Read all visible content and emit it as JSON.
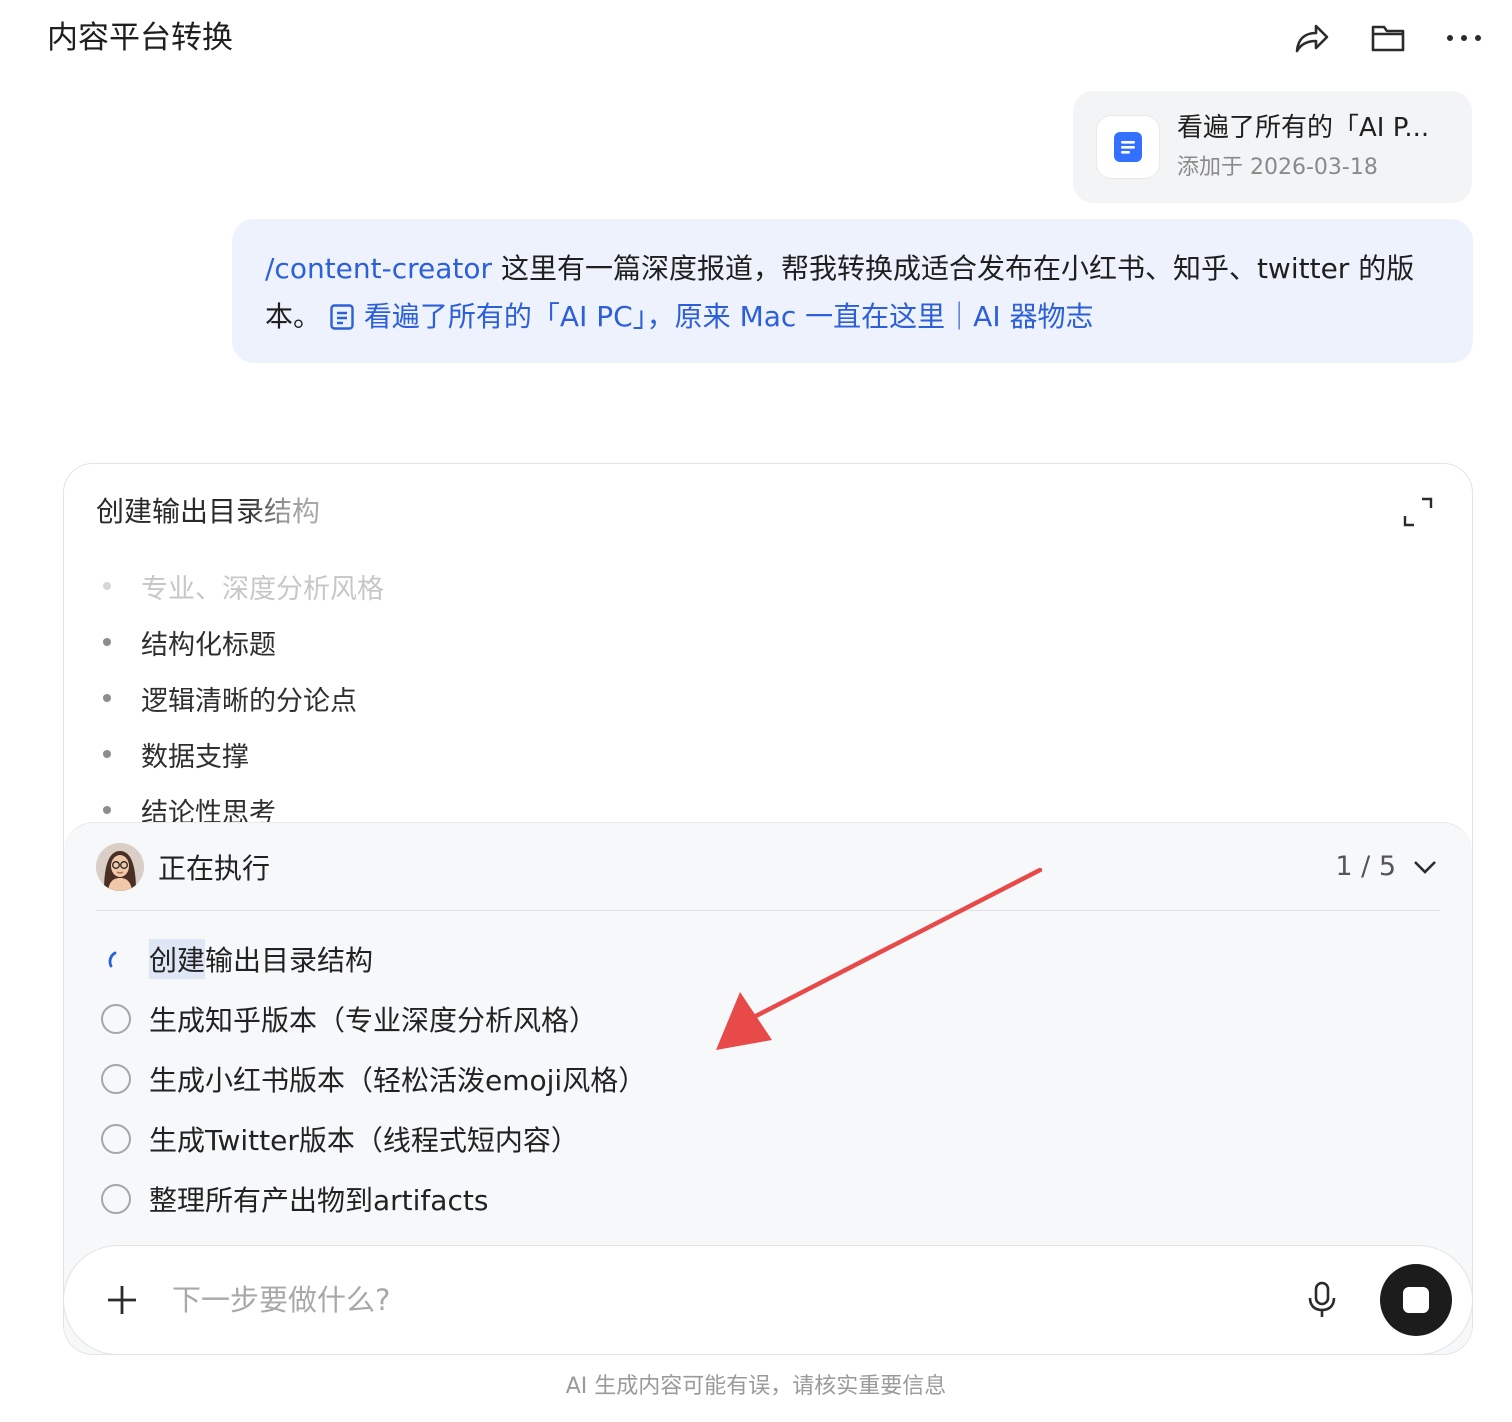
{
  "header": {
    "title": "内容平台转换",
    "actions": [
      "share-icon",
      "folder-icon",
      "more-icon"
    ]
  },
  "attachment": {
    "title": "看遍了所有的「AI P...",
    "date": "添加于 2026-03-18",
    "icon": "document-icon",
    "icon_color": "#3370ff"
  },
  "user_message": {
    "command": "/content-creator",
    "text": " 这里有一篇深度报道，帮我转换成适合发布在小红书、知乎、twitter 的版本。",
    "doc_link": "看遍了所有的「AI PC」，原来 Mac 一直在这里｜AI 器物志"
  },
  "artifact": {
    "title": "创建输出目录结构",
    "bullets": [
      "专业、深度分析风格",
      "结构化标题",
      "逻辑清晰的分论点",
      "数据支撑",
      "结论性思考"
    ]
  },
  "task_panel": {
    "status": "正在执行",
    "progress": "1 / 5",
    "tasks": [
      {
        "highlight": "创建",
        "rest": "输出目录结构",
        "state": "running"
      },
      {
        "label": "生成知乎版本（专业深度分析风格）",
        "state": "pending"
      },
      {
        "label": "生成小红书版本（轻松活泼emoji风格）",
        "state": "pending"
      },
      {
        "label": "生成Twitter版本（线程式短内容）",
        "state": "pending"
      },
      {
        "label": "整理所有产出物到artifacts",
        "state": "pending"
      }
    ]
  },
  "input": {
    "placeholder": "下一步要做什么?"
  },
  "disclaimer": "AI 生成内容可能有误，请核实重要信息",
  "colors": {
    "accent": "#2c5fd9",
    "message_bg": "#edf2fd",
    "annotation_arrow": "#e84a4a"
  }
}
